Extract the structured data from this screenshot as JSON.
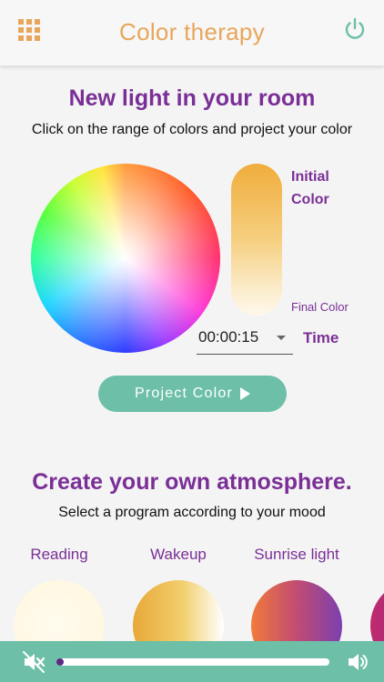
{
  "header": {
    "title": "Color therapy",
    "menu_icon": "grid-icon",
    "power_icon": "power-icon",
    "accent_color": "#e8a65a",
    "power_color": "#6dbfa8"
  },
  "light_section": {
    "heading": "New light in your room",
    "subtitle": "Click on the range of colors and project your color",
    "initial_label": "Initial Color",
    "final_label": "Final Color",
    "time_value": "00:00:15",
    "time_label": "Time",
    "project_button": "Project Color",
    "initial_color": "#f0ad3c",
    "final_color": "#fff8ec"
  },
  "atmosphere_section": {
    "heading": "Create your own atmosphere.",
    "subtitle": "Select a program according to your mood",
    "programs": [
      {
        "label": "Reading",
        "colors": [
          "#fffbe8",
          "#fff6dc"
        ]
      },
      {
        "label": "Wakeup",
        "colors": [
          "#e8a838",
          "#ffffff"
        ]
      },
      {
        "label": "Sunrise light",
        "colors": [
          "#f07a3a",
          "#7b3fb0"
        ]
      },
      {
        "label": "",
        "colors": [
          "#c02a6e",
          "#7a2f96"
        ]
      }
    ]
  },
  "player": {
    "mute_icon": "mute-icon",
    "volume_icon": "volume-icon",
    "progress": 0.0
  },
  "colors": {
    "purple": "#7a2f96",
    "teal": "#6dbfa8"
  }
}
